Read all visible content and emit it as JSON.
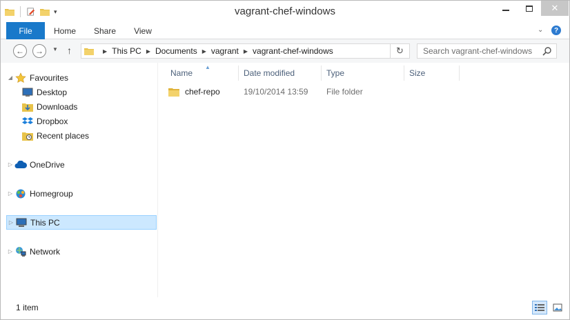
{
  "window": {
    "title": "vagrant-chef-windows"
  },
  "ribbon": {
    "file_label": "File",
    "tabs": [
      "Home",
      "Share",
      "View"
    ]
  },
  "address": {
    "breadcrumbs": [
      "This PC",
      "Documents",
      "vagrant",
      "vagrant-chef-windows"
    ]
  },
  "search": {
    "placeholder": "Search vagrant-chef-windows"
  },
  "navpane": {
    "favourites": {
      "label": "Favourites",
      "children": [
        "Desktop",
        "Downloads",
        "Dropbox",
        "Recent places"
      ]
    },
    "onedrive": "OneDrive",
    "homegroup": "Homegroup",
    "thispc": "This PC",
    "network": "Network"
  },
  "columns": {
    "name": "Name",
    "date": "Date modified",
    "type": "Type",
    "size": "Size"
  },
  "files": [
    {
      "name": "chef-repo",
      "date": "19/10/2014 13:59",
      "type": "File folder",
      "size": ""
    }
  ],
  "status": {
    "count": "1 item"
  },
  "colors": {
    "accent": "#1979ca",
    "selection": "#cce8ff",
    "selection_border": "#99d1ff",
    "folder": "#e8c34a"
  }
}
